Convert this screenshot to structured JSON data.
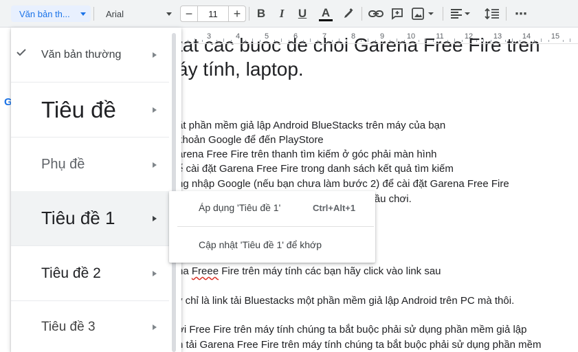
{
  "toolbar": {
    "style_value": "Văn bản th...",
    "font_value": "Arial",
    "font_size": "11",
    "minus": "−",
    "plus": "+",
    "bold": "B",
    "italic": "I",
    "underline": "U",
    "text_color": "A",
    "more": "⋯",
    "icons": [
      "bold-icon",
      "italic-icon",
      "underline-icon",
      "text-color-icon",
      "highlight-icon",
      "link-icon",
      "comment-icon",
      "image-icon",
      "align-icon",
      "line-spacing-icon",
      "more-icon"
    ]
  },
  "ruler": {
    "numbers": [
      "3",
      "4",
      "5",
      "6",
      "7",
      "8",
      "9",
      "10",
      "11",
      "12",
      "13",
      "14",
      "15"
    ]
  },
  "document": {
    "lines": [
      "tat cac buoc de choi Garena Free Fire tren",
      "áy tính, laptop.",
      "ặt phần mềm giả lập Android BlueStacks trên máy của bạn",
      " khoản Google để đến PlayStore",
      "arena Free Fire trên thanh tìm kiếm ở góc phải màn hình",
      "ể cài đặt Garena Free Fire trong danh sách kết quả tìm kiếm",
      "ng nhập Google (nếu bạn chưa làm bước 2) để cài đặt Garena Free Fire",
      "n để bắt đầu chơi.",
      "na ",
      "Freee",
      " Fire trên máy tính các bạn hãy click vào link sau",
      "y chỉ là link tải Bluestacks một phần mềm giả lập Android trên PC mà thôi.",
      "ơi Free Fire trên máy tính chúng ta bắt buộc phải sử dụng phần mềm giả lập",
      "n tải Garena Free Fire trên máy tính chúng ta bắt buộc phải sử dụng phần mềm"
    ],
    "edge_letter": "G"
  },
  "style_menu": {
    "items": [
      {
        "label": "Văn bản thường",
        "checked": true
      },
      {
        "label": "Tiêu đề"
      },
      {
        "label": "Phụ đề"
      },
      {
        "label": "Tiêu đề 1",
        "active": true
      },
      {
        "label": "Tiêu đề 2"
      },
      {
        "label": "Tiêu đề 3"
      }
    ]
  },
  "submenu": {
    "apply_label": "Áp dụng 'Tiêu đề 1'",
    "apply_shortcut": "Ctrl+Alt+1",
    "update_label": "Cập nhật 'Tiêu đề 1' để khớp"
  },
  "colors": {
    "accent": "#1a73e8",
    "toolbar_bg": "#f1f3f4",
    "spell_error": "#d93025"
  }
}
